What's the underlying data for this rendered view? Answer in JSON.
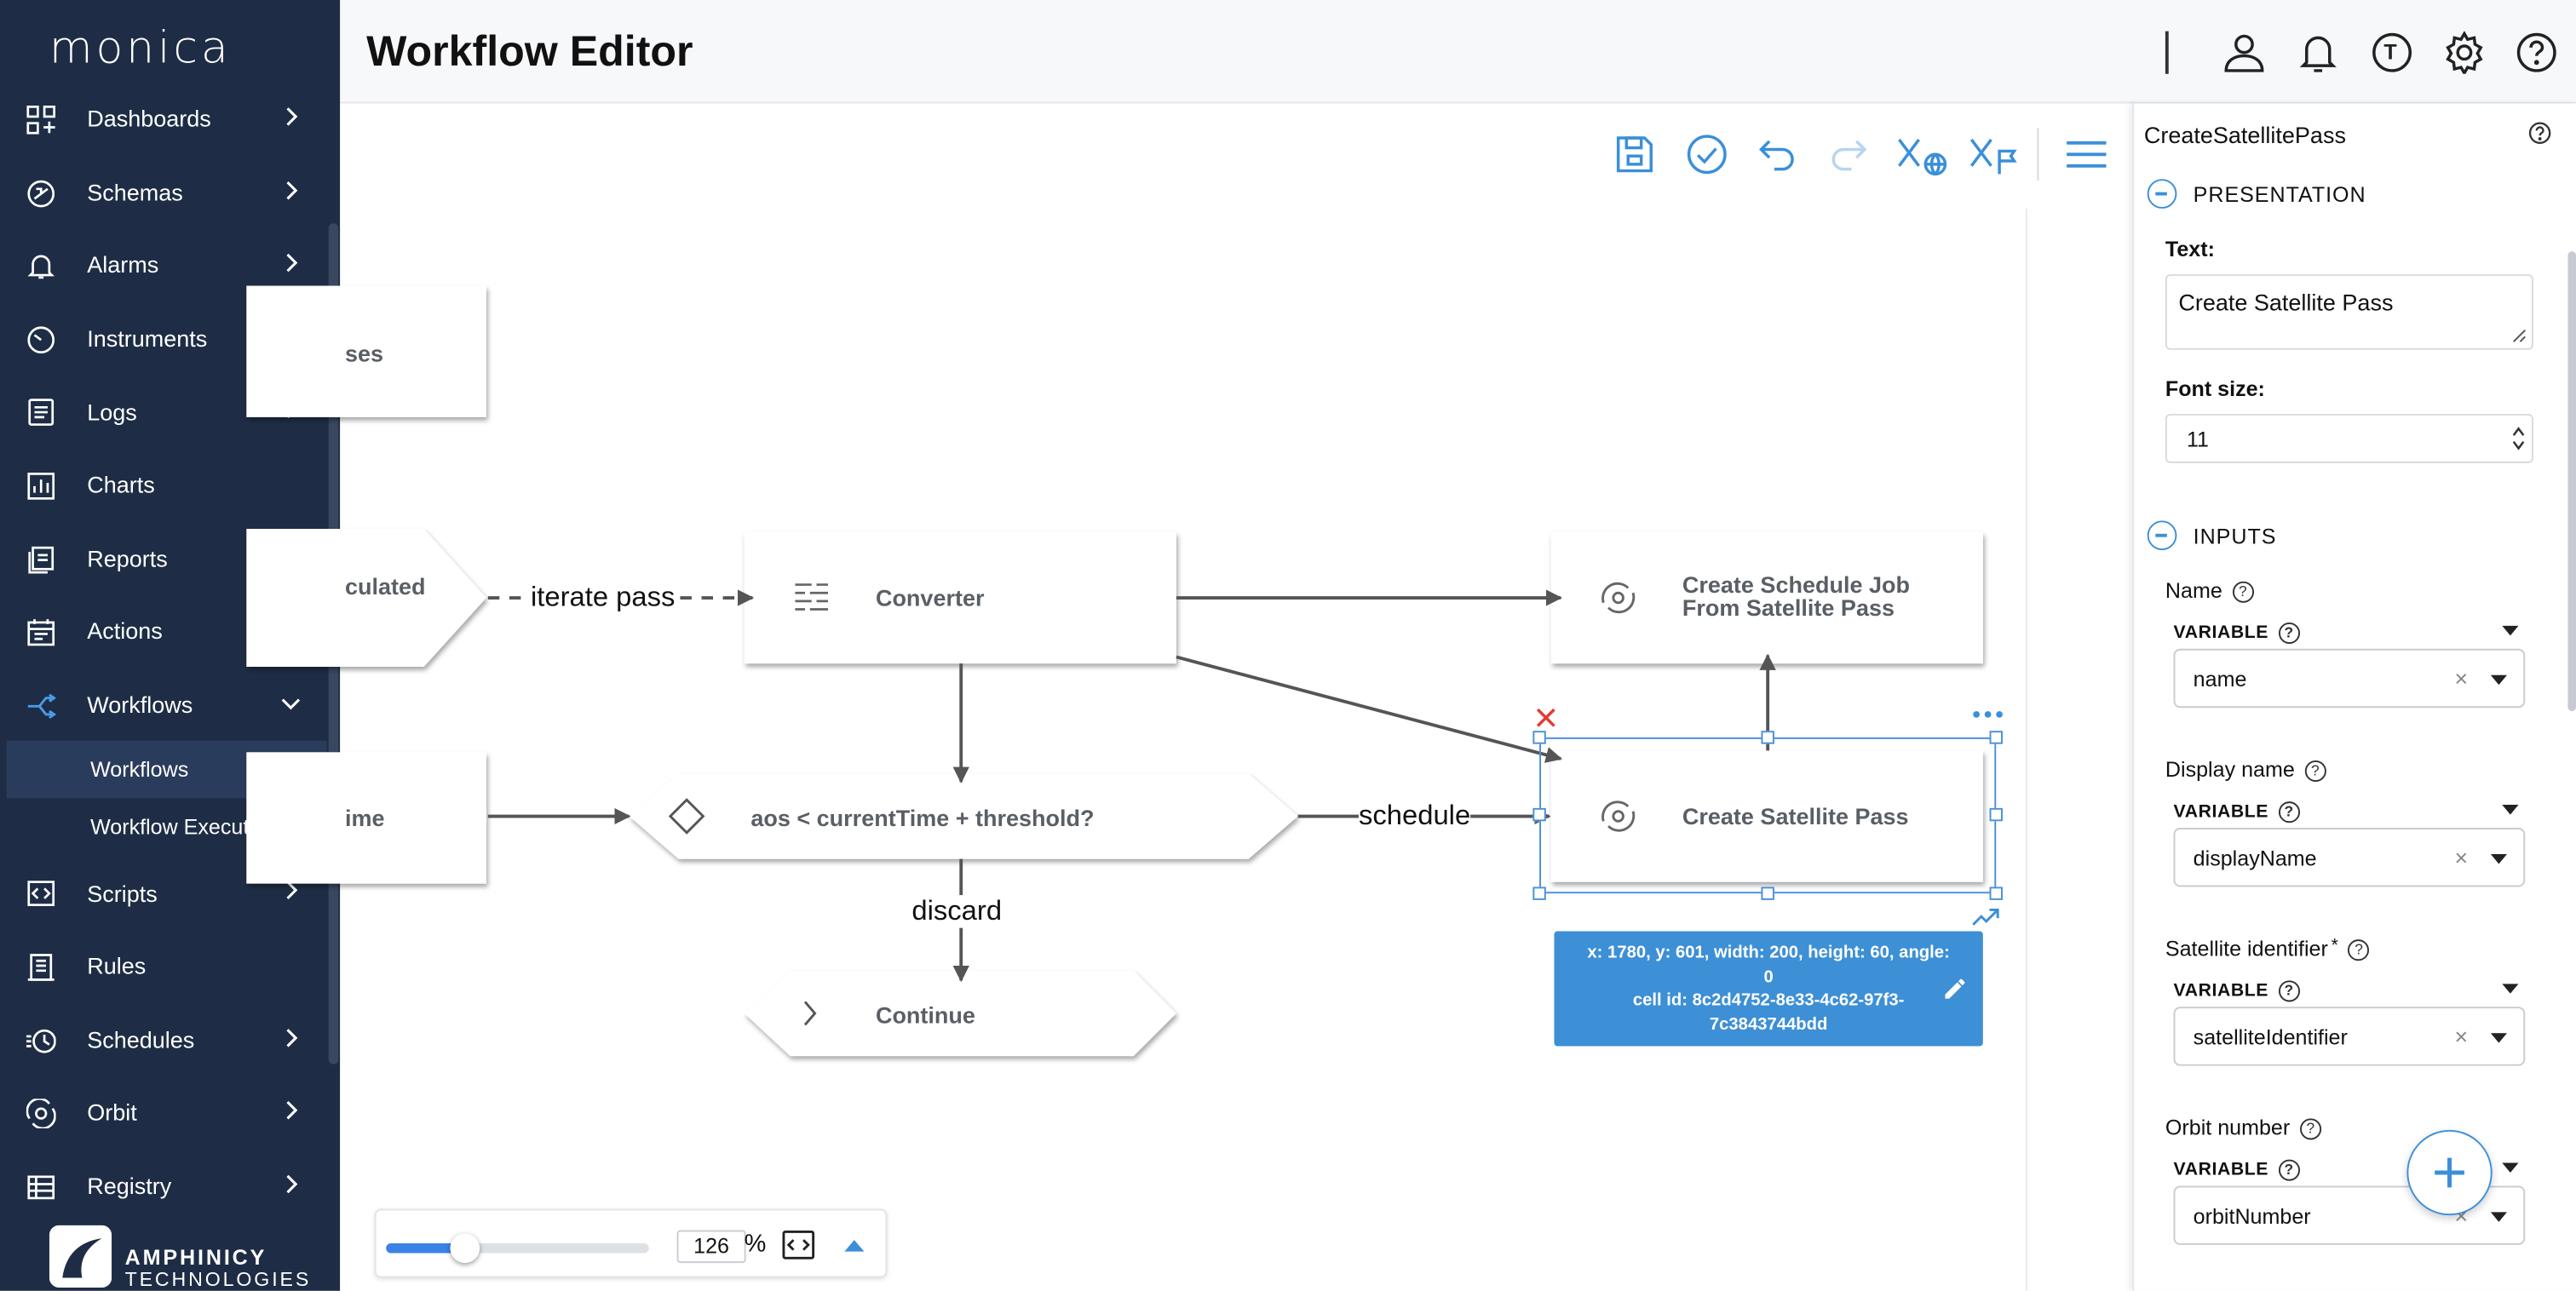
{
  "app": {
    "name": "monica"
  },
  "sidebar": {
    "items": [
      {
        "label": "Dashboards",
        "icon": "dashboard-icon",
        "chevron": "right"
      },
      {
        "label": "Schemas",
        "icon": "schema-icon",
        "chevron": "right"
      },
      {
        "label": "Alarms",
        "icon": "bell-icon",
        "chevron": "right"
      },
      {
        "label": "Instruments",
        "icon": "gauge-icon",
        "chevron": "right"
      },
      {
        "label": "Logs",
        "icon": "log-icon",
        "chevron": "right"
      },
      {
        "label": "Charts",
        "icon": "chart-icon",
        "chevron": ""
      },
      {
        "label": "Reports",
        "icon": "report-icon",
        "chevron": "right"
      },
      {
        "label": "Actions",
        "icon": "calendar-icon",
        "chevron": "right"
      },
      {
        "label": "Workflows",
        "icon": "workflow-icon",
        "chevron": "down"
      },
      {
        "label": "Scripts",
        "icon": "script-icon",
        "chevron": "right"
      },
      {
        "label": "Rules",
        "icon": "rules-icon",
        "chevron": ""
      },
      {
        "label": "Schedules",
        "icon": "schedule-icon",
        "chevron": "right"
      },
      {
        "label": "Orbit",
        "icon": "orbit-icon",
        "chevron": "right"
      },
      {
        "label": "Registry",
        "icon": "registry-icon",
        "chevron": "right"
      }
    ],
    "workflow_subitems": [
      {
        "label": "Workflows",
        "active": true
      },
      {
        "label": "Workflow Executions",
        "active": false
      }
    ],
    "brand": {
      "name": "AMPHINICY",
      "sub": "TECHNOLOGIES"
    }
  },
  "header": {
    "title": "Workflow Editor",
    "icons": [
      "user-icon",
      "bell-icon",
      "timezone-icon",
      "gear-icon",
      "help-icon"
    ],
    "timezone_letter": "T"
  },
  "toolbar": {
    "icons": [
      "save-icon",
      "validate-icon",
      "undo-icon",
      "redo-icon",
      "global-variables-icon",
      "flow-variables-icon",
      "menu-icon"
    ]
  },
  "canvas": {
    "nodes": {
      "partial_top": "ses",
      "partial_calc": "culated",
      "converter": "Converter",
      "create_schedule_line1": "Create Schedule Job",
      "create_schedule_line2": "From Satellite Pass",
      "partial_time": "ime",
      "condition": "aos < currentTime + threshold?",
      "create_pass": "Create Satellite Pass",
      "continue": "Continue"
    },
    "edges": {
      "iterate": "iterate pass",
      "schedule": "schedule",
      "discard": "discard"
    },
    "selection_info": {
      "line1": "x: 1780, y: 601, width: 200, height: 60, angle:",
      "line2": "0",
      "line3": "cell id: 8c2d4752-8e33-4c62-97f3-",
      "line4": "7c3843744bdd"
    }
  },
  "zoom": {
    "value": "126",
    "unit": "%",
    "level": 0.3
  },
  "panel": {
    "title": "CreateSatellitePass",
    "presentation": {
      "header": "PRESENTATION",
      "text_label": "Text:",
      "text_value": "Create Satellite Pass",
      "font_label": "Font size:",
      "font_value": "11"
    },
    "inputs": {
      "header": "INPUTS",
      "fields": [
        {
          "label": "Name",
          "required": false,
          "mode": "VARIABLE",
          "value": "name"
        },
        {
          "label": "Display name",
          "required": false,
          "mode": "VARIABLE",
          "value": "displayName"
        },
        {
          "label": "Satellite identifier",
          "required": true,
          "mode": "VARIABLE",
          "value": "satelliteIdentifier"
        },
        {
          "label": "Orbit number",
          "required": false,
          "mode": "VARIABLE",
          "value": "orbitNumber"
        }
      ]
    }
  },
  "colors": {
    "sidebar_bg": "#1e2d45",
    "accent": "#3b8fd9",
    "info_box": "#3d8fd6",
    "delete": "#e53935"
  }
}
